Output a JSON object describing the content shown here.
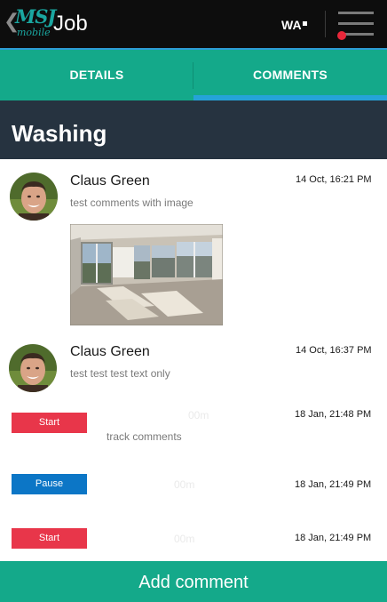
{
  "app_bar": {
    "back_glyph": "❮",
    "logo_main": "MSJ",
    "logo_sub": "mobile",
    "title": "Job",
    "user_code": "WA"
  },
  "tabs": [
    {
      "label": "DETAILS",
      "active": false
    },
    {
      "label": "COMMENTS",
      "active": true
    }
  ],
  "section": {
    "title": "Washing"
  },
  "comments": [
    {
      "author": "Claus  Green",
      "timestamp": "14 Oct, 16:21 PM",
      "text": "test comments with image",
      "has_image": true
    },
    {
      "author": "Claus  Green",
      "timestamp": "14 Oct, 16:37 PM",
      "text": "test  test test text only",
      "has_image": false
    }
  ],
  "events": [
    {
      "status": "Start",
      "color": "#e8364a",
      "duration": "00m",
      "timestamp": "18 Jan, 21:48 PM",
      "note": "track comments"
    },
    {
      "status": "Pause",
      "color": "#0c76c6",
      "duration": "00m",
      "timestamp": "18 Jan, 21:49 PM",
      "note": ""
    },
    {
      "status": "Start",
      "color": "#e8364a",
      "duration": "00m",
      "timestamp": "18 Jan, 21:49 PM",
      "note": ""
    }
  ],
  "footer": {
    "button_label": "Add comment"
  },
  "colors": {
    "primary_green": "#14a98a",
    "tab_indicator": "#25a3d8",
    "header_dark": "#263340",
    "start_red": "#e8364a",
    "pause_blue": "#0c76c6",
    "notification_dot": "#e8273a"
  },
  "icons": [
    "back-chevron-icon",
    "msj-logo",
    "menu-icon",
    "notification-dot"
  ]
}
